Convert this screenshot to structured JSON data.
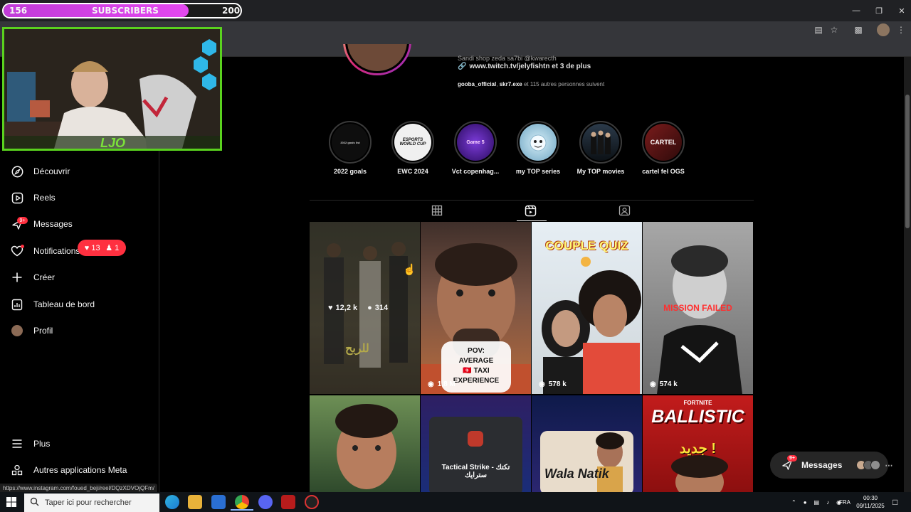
{
  "overlay": {
    "sub_current": "156",
    "sub_label": "SUBSCRIBERS",
    "sub_goal": "200",
    "sub_progress": 0.78,
    "webcam_tag": "LJO"
  },
  "browser": {
    "minimize_icon": "minimize-icon",
    "restore_icon": "restore-icon",
    "close_icon": "close-icon"
  },
  "sidebar": {
    "items": [
      {
        "label": "Découvrir",
        "icon": "compass-icon"
      },
      {
        "label": "Reels",
        "icon": "reels-icon"
      },
      {
        "label": "Messages",
        "icon": "messenger-icon"
      },
      {
        "label": "Notifications",
        "icon": "heart-icon"
      },
      {
        "label": "Créer",
        "icon": "plus-icon"
      },
      {
        "label": "Tableau de bord",
        "icon": "dashboard-icon"
      },
      {
        "label": "Profil",
        "icon": "avatar"
      }
    ],
    "messages_badge": "9+",
    "notif_likes": "13",
    "notif_follows": "1",
    "more": "Plus",
    "meta_apps": "Autres applications Meta"
  },
  "profile": {
    "bio_line": "Sandi shop zeda sa7bi @kwarecth",
    "link": "www.twitch.tv/jelyfishtn et 3 de plus",
    "followed_by_1": "gooba_official",
    "followed_by_sep": ", ",
    "followed_by_2": "skr7.exe",
    "followed_by_rest": " et 115 autres personnes suivent"
  },
  "highlights": [
    {
      "label": "2022 goals",
      "inner": "2022 goals list"
    },
    {
      "label": "EWC 2024",
      "inner": "ESPORTS WORLD CUP"
    },
    {
      "label": "Vct copenhag...",
      "inner": "Game 5"
    },
    {
      "label": "my TOP series",
      "inner": ""
    },
    {
      "label": "My TOP movies",
      "inner": ""
    },
    {
      "label": "cartel fel OGS",
      "inner": "CARTEL"
    }
  ],
  "tabs": {
    "posts": "grid-icon",
    "reels": "reels-icon",
    "tagged": "tagged-icon",
    "active": "reels"
  },
  "reels": [
    {
      "likes": "12,2 k",
      "comments": "314",
      "overlay_text": "للربح"
    },
    {
      "views": "1,8 M",
      "overlay_text": "POV:\nAVERAGE\n🇹🇳 TAXI\nEXPERIENCE"
    },
    {
      "views": "578 k",
      "overlay_text": "COUPLE QUIZ"
    },
    {
      "views": "574 k",
      "overlay_text": "MISSION FAILED"
    },
    {
      "overlay_text": ""
    },
    {
      "overlay_text": "Tactical Strike - تكتك سترايك"
    },
    {
      "overlay_text": "Wala Natik"
    },
    {
      "overlay_text": "BALLISTIC",
      "overlay_sub": "جديد !",
      "overlay_top": "FORTNITE"
    }
  ],
  "messages_pill": {
    "label": "Messages",
    "badge": "9+"
  },
  "status_url": "https://www.instagram.com/foued_beji/reel/DQzXDVOjQFm/",
  "taskbar": {
    "search_placeholder": "Taper ici pour rechercher",
    "lang": "FRA",
    "time": "00:30",
    "date": "09/11/2025"
  }
}
